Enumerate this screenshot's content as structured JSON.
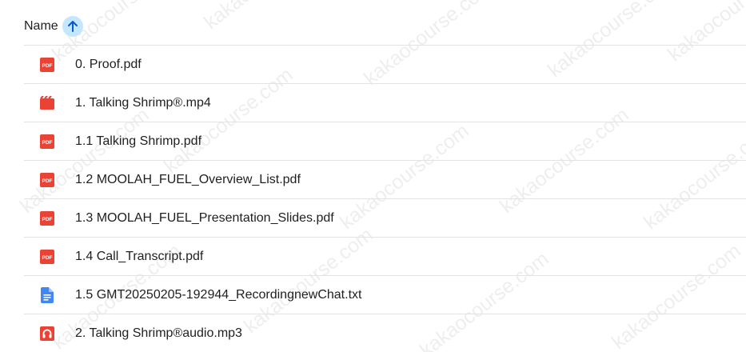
{
  "header": {
    "name_label": "Name"
  },
  "files": [
    {
      "name": "0. Proof.pdf",
      "icon": "pdf-icon"
    },
    {
      "name": "1. Talking Shrimp®.mp4",
      "icon": "video-icon"
    },
    {
      "name": "1.1 Talking Shrimp.pdf",
      "icon": "pdf-icon"
    },
    {
      "name": "1.2 MOOLAH_FUEL_Overview_List.pdf",
      "icon": "pdf-icon"
    },
    {
      "name": "1.3 MOOLAH_FUEL_Presentation_Slides.pdf",
      "icon": "pdf-icon"
    },
    {
      "name": "1.4 Call_Transcript.pdf",
      "icon": "pdf-icon"
    },
    {
      "name": "1.5 GMT20250205-192944_RecordingnewChat.txt",
      "icon": "doc-icon"
    },
    {
      "name": "2. Talking Shrimp®audio.mp3",
      "icon": "audio-icon"
    }
  ],
  "icon_text": {
    "pdf": "PDF"
  },
  "watermark": "kakaocourse.com",
  "colors": {
    "pdf_red": "#ea4335",
    "doc_blue": "#4285f4",
    "sort_bg": "#c2e7ff",
    "arrow": "#0b57d0",
    "divider": "#e3e3e3"
  }
}
